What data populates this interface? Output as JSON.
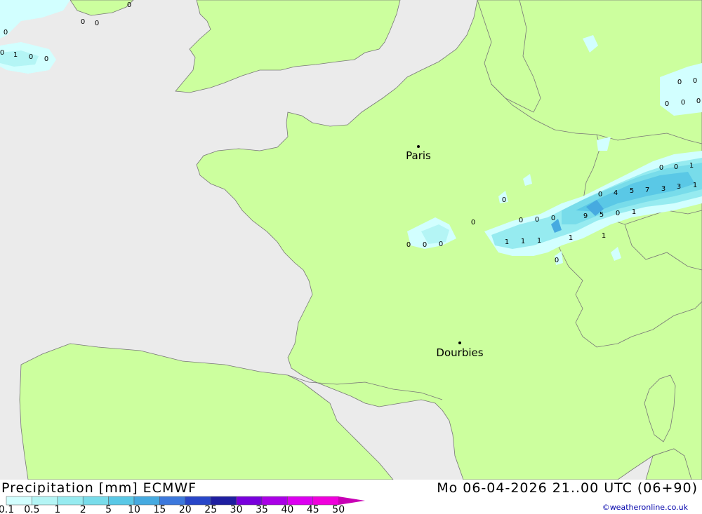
{
  "header": {
    "title": "Precipitation [mm] ECMWF",
    "valid_time": "Mo 06-04-2026 21..00 UTC (06+90)",
    "credit": "©weatheronline.co.uk"
  },
  "colors": {
    "sea": "#ebebeb",
    "land": "#ccff9e",
    "border": "#777777"
  },
  "legend": {
    "labels": [
      "0.1",
      "0.5",
      "1",
      "2",
      "5",
      "10",
      "15",
      "20",
      "25",
      "30",
      "35",
      "40",
      "45",
      "50"
    ],
    "colors": [
      "#d2ffff",
      "#b4f5f5",
      "#96ebf0",
      "#78dcea",
      "#5ac8e6",
      "#46aae0",
      "#3c78dc",
      "#2846c8",
      "#1e1ea0",
      "#7800dc",
      "#aa00e6",
      "#dc00f0",
      "#f000dc",
      "#c800b4"
    ]
  },
  "cities": [
    {
      "name": "Paris"
    },
    {
      "name": "Dourbies"
    }
  ],
  "precip_values": [
    "0",
    "0",
    "0",
    "0",
    "1",
    "0",
    "0",
    "0",
    "0",
    "0",
    "0",
    "0",
    "0",
    "0",
    "0",
    "1",
    "1",
    "0",
    "4",
    "5",
    "7",
    "3",
    "3",
    "1",
    "0",
    "0",
    "0",
    "0",
    "0",
    "0",
    "0",
    "0",
    "1",
    "1",
    "9",
    "5",
    "0",
    "1",
    "1",
    "1",
    "0"
  ]
}
